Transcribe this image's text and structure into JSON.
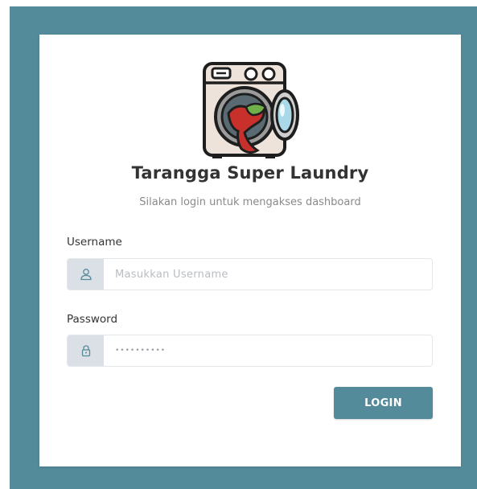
{
  "app": {
    "title": "Tarangga Super Laundry",
    "subtitle": "Silakan login untuk mengakses dashboard",
    "logo_icon": "washing-machine-icon"
  },
  "form": {
    "username_label": "Username",
    "username_placeholder": "Masukkan Username",
    "username_icon": "user-icon",
    "password_label": "Password",
    "password_value": "••••••••••",
    "password_icon": "lock-icon",
    "login_label": "LOGIN"
  },
  "colors": {
    "accent": "#548b9b",
    "addon_bg": "#dbe0e6",
    "background": "#ffffff"
  }
}
